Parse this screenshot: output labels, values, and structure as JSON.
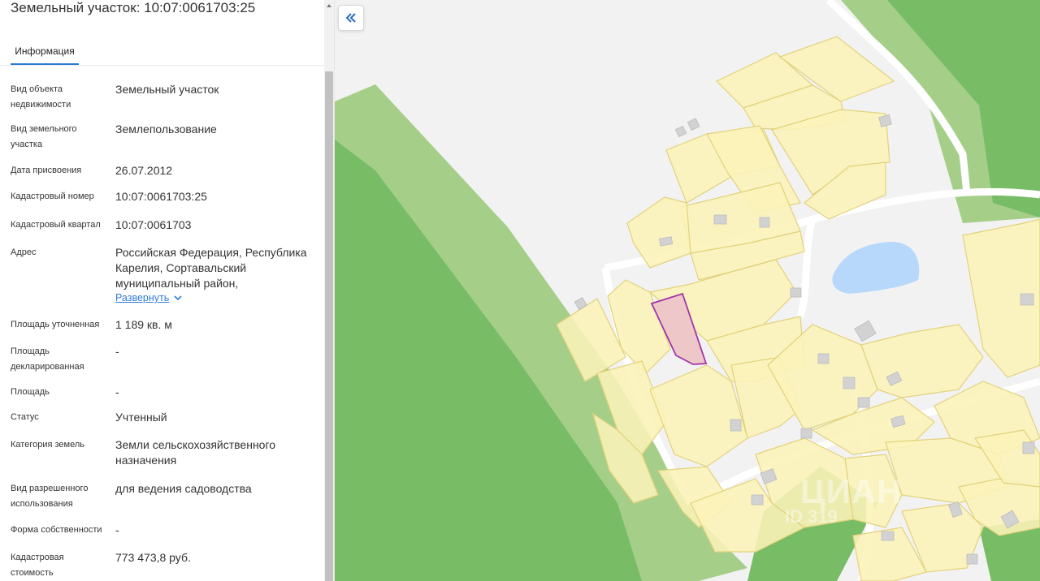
{
  "panel": {
    "title": "Земельный участок: 10:07:0061703:25",
    "tab_label": "Информация",
    "expand_link": "Развернуть",
    "fields": [
      {
        "label": "Вид объекта недвижимости",
        "value": "Земельный участок"
      },
      {
        "label": "Вид земельного участка",
        "value": "Землепользование"
      },
      {
        "label": "Дата присвоения",
        "value": "26.07.2012"
      },
      {
        "label": "Кадастровый номер",
        "value": "10:07:0061703:25"
      },
      {
        "label": "Кадастровый квартал",
        "value": "10:07:0061703"
      },
      {
        "label": "Адрес",
        "value": "Российская Федерация, Республика Карелия, Сортавальский муниципальный район,"
      },
      {
        "label": "Площадь уточненная",
        "value": "1 189 кв. м"
      },
      {
        "label": "Площадь декларированная",
        "value": "-"
      },
      {
        "label": "Площадь",
        "value": "-"
      },
      {
        "label": "Статус",
        "value": "Учтенный"
      },
      {
        "label": "Категория земель",
        "value": "Земли сельскохозяйственного назначения"
      },
      {
        "label": "Вид разрешенного использования",
        "value": "для ведения садоводства"
      },
      {
        "label": "Форма собственности",
        "value": "-"
      },
      {
        "label": "Кадастровая стоимость",
        "value": "773 473,8 руб."
      }
    ]
  },
  "map": {
    "watermark_logo": "ЦИАН",
    "watermark_id": "ID 319",
    "colors": {
      "background": "#f2f2f2",
      "forest_dark": "#78bd66",
      "forest_light": "#a5cf89",
      "parcel_fill": "#fbf3b8",
      "parcel_stroke": "#e2d27a",
      "selected_fill": "#eec7c9",
      "selected_stroke": "#a035a6",
      "water": "#b8d8fb",
      "building": "#d2d2d2"
    }
  },
  "icons": {
    "collapse": "double-chevron-left-icon",
    "expand": "chevron-down-icon"
  }
}
